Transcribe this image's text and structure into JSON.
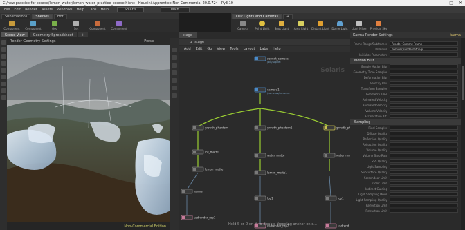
{
  "window": {
    "title": "C:/new practice for course/lemon_water/lemon_water_practice_course.hipnc - Houdini Apprentice Non-Commercial 20.0.724 - Py3.10",
    "controls": [
      "–",
      "□",
      "✕"
    ]
  },
  "menubar": {
    "items": [
      "File",
      "Edit",
      "Render",
      "Assets",
      "Windows",
      "Help",
      "Labs",
      "Help"
    ],
    "desktop": "Solaris",
    "desktop2": "Main"
  },
  "shelf_left": {
    "tabs": [
      "Sublimations",
      "Shelves",
      "Hot"
    ],
    "tools": [
      "Component",
      "Component",
      "Geo",
      "Set",
      "Component",
      "Component"
    ]
  },
  "shelf_right": {
    "tabs": [
      "LOP Lights and Cameras",
      "+"
    ],
    "tools": [
      "Camera",
      "Point Light",
      "Spot Light",
      "Area Light",
      "Distant Light",
      "Dome Light",
      "Light Mixer",
      "Physical Sky"
    ]
  },
  "panel_tabs": [
    "Scene View",
    "Geometry Spreadsheet",
    "+"
  ],
  "viewport": {
    "camera": "Render Geometry Settings",
    "persp": "Persp",
    "status": "Non-Commercial Edition"
  },
  "network": {
    "tab": "stage",
    "path": "stage",
    "menu": [
      "Add",
      "Edit",
      "Go",
      "View",
      "Tools",
      "Layout",
      "Labs",
      "Help"
    ],
    "context": "Solaris",
    "nodes": [
      {
        "name": "sopnet_camera",
        "sub": "/obj/sopnet",
        "kind": "blue"
      },
      {
        "name": "camera1",
        "sub": "/cameras/camera1",
        "kind": "blue"
      },
      {
        "name": "growth_phantom",
        "sub": "",
        "kind": "grey"
      },
      {
        "name": "growth_phantom1",
        "sub": "",
        "kind": "grey"
      },
      {
        "name": "growth_ph",
        "sub": "",
        "kind": "yellow"
      },
      {
        "name": "ice_matte",
        "sub": "",
        "kind": "grey"
      },
      {
        "name": "water_matte",
        "sub": "",
        "kind": "grey"
      },
      {
        "name": "water_ma",
        "sub": "",
        "kind": "grey"
      },
      {
        "name": "lemon_matte",
        "sub": "",
        "kind": "grey"
      },
      {
        "name": "lemon_matte1",
        "sub": "",
        "kind": "grey"
      },
      {
        "name": "karma",
        "sub": "",
        "kind": "grey"
      },
      {
        "name": "lop1",
        "sub": "",
        "kind": "grey"
      },
      {
        "name": "lop1",
        "sub": "",
        "kind": "grey"
      },
      {
        "name": "usdrender_rop1",
        "sub": "",
        "kind": "pink"
      },
      {
        "name": "usdrender_rop2",
        "sub": "",
        "kind": "pink"
      },
      {
        "name": "usdrend",
        "sub": "",
        "kind": "pink"
      }
    ]
  },
  "params": {
    "header": "Karma Render Settings",
    "node_name": "karma",
    "rows_top": [
      {
        "label": "Frame Range/Subframes",
        "value": "Render Current Frame"
      },
      {
        "label": "Primitive",
        "value": "/Render/rendersettings"
      },
      {
        "label": "Initialize Parameters",
        "value": ""
      }
    ],
    "section1": "Motion Blur",
    "rows1": [
      "Enable Motion Blur",
      "Geometry Time Samples",
      "Deformation Blur",
      "Velocity Blur",
      "Transform Samples",
      "Geometry Time",
      "Animated Velocity",
      "Animated Velocity",
      "Volume Velocity",
      "Acceleration Att."
    ],
    "section2": "Sampling",
    "rows2": [
      "Pixel Samples",
      "Diffuse Quality",
      "Reflection Quality",
      "Refraction Quality",
      "Volume Quality",
      "Volume Step Rate",
      "SSS Quality",
      "Light Sampling",
      "Subsurface Quality",
      "Screendoor Limit",
      "Color Limit",
      "Indirect Guiding",
      "Light Sampling Mode",
      "Light Sampling Quality",
      "Reflection Limit",
      "Refraction Limit"
    ]
  },
  "subtitle": "Hold S or D on M to disable dropping anchor on o..."
}
